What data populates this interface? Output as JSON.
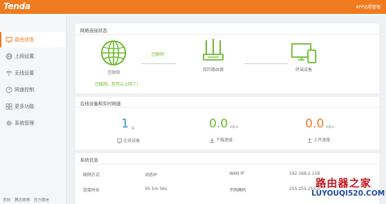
{
  "header": {
    "logo": "Tenda",
    "app_link": "APP远程管理"
  },
  "sidebar": {
    "items": [
      {
        "label": "路由状态",
        "icon": "monitor-icon"
      },
      {
        "label": "上网设置",
        "icon": "globe-icon"
      },
      {
        "label": "无线设置",
        "icon": "wifi-icon"
      },
      {
        "label": "网速控制",
        "icon": "speedometer-icon"
      },
      {
        "label": "更多功能",
        "icon": "grid-icon"
      },
      {
        "label": "系统管理",
        "icon": "gear-icon"
      }
    ],
    "footer": [
      "官网",
      "腾达微博",
      "官方微信"
    ]
  },
  "network_status": {
    "title": "网络连接状态",
    "internet_label": "互联网",
    "link_status": "已联网",
    "router_label": "我的路由器",
    "terminal_label": "终端设备",
    "online_message": "已联网，您可以上网了！"
  },
  "realtime": {
    "title": "在线设备和实时网速",
    "devices": {
      "value": "1",
      "unit": "台",
      "label": "在线设备"
    },
    "download": {
      "value": "0.0",
      "unit": "KB/s",
      "label": "下载速度"
    },
    "upload": {
      "value": "0.0",
      "unit": "KB/s",
      "label": "上传速度"
    }
  },
  "system_info": {
    "title": "系统信息",
    "rows": [
      {
        "k1": "联网方式",
        "v1": "动态IP",
        "k2": "WAN IP",
        "v2": "192.168.2.118"
      },
      {
        "k1": "连接时长",
        "v1": "5h 5m 56s",
        "k2": "子网掩码",
        "v2": "255.255.255.0"
      }
    ]
  },
  "watermark": {
    "title": "路由器之家",
    "url": "LUYOUQI520.COM"
  },
  "colors": {
    "brand_orange": "#f07b1f",
    "online_green": "#6aba2c",
    "devices_blue": "#2e8fd6",
    "download_green": "#6aba2c",
    "upload_orange": "#f07b1f"
  }
}
